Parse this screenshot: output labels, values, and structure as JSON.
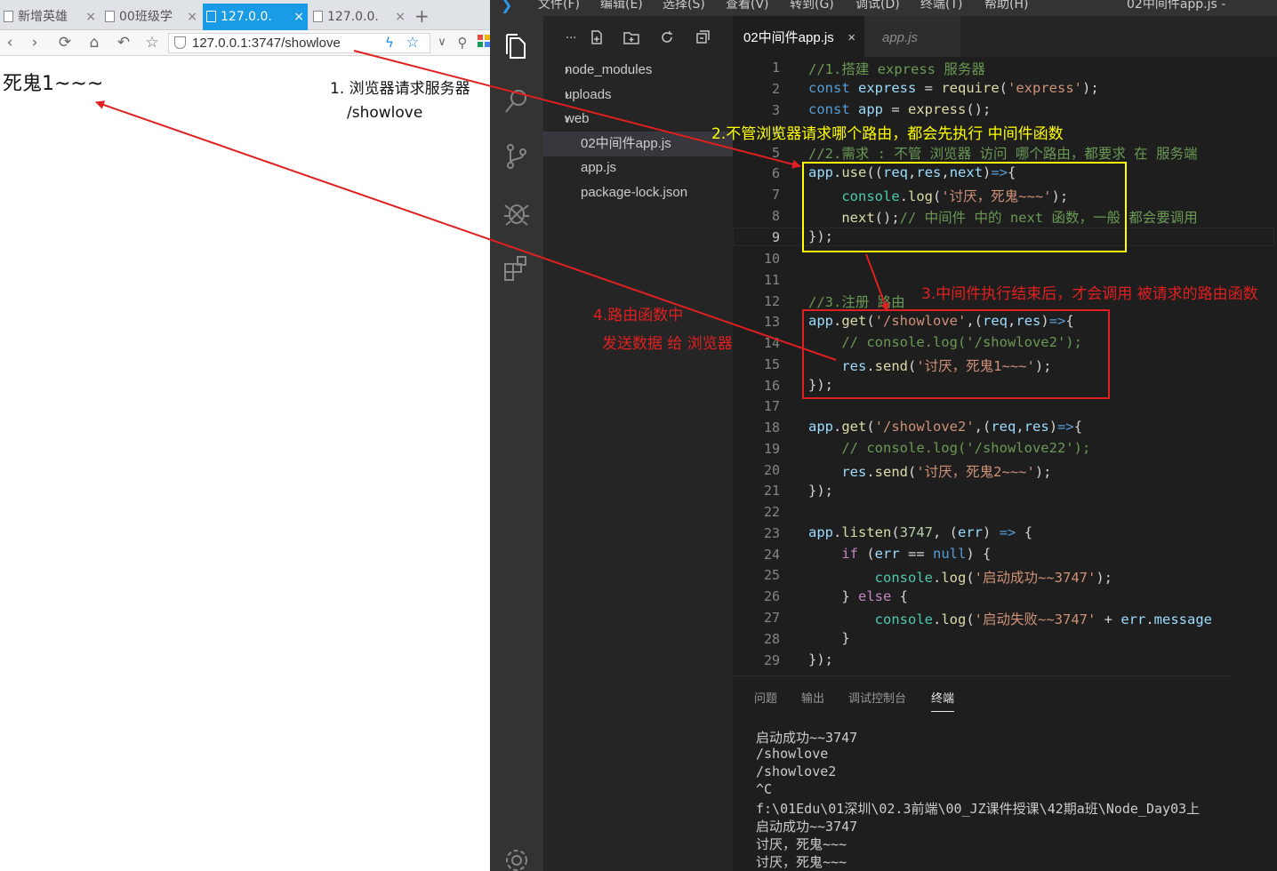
{
  "browser": {
    "tabs": [
      {
        "label": "新增英雄",
        "close": "×"
      },
      {
        "label": "00班级学",
        "close": "×"
      },
      {
        "label": "127.0.0.",
        "close": "×"
      },
      {
        "label": "127.0.0.",
        "close": "×"
      }
    ],
    "new_tab": "+",
    "url": "127.0.0.1:3747/showlove",
    "page_text": "死鬼1~~~"
  },
  "vscode": {
    "menu": [
      "文件(F)",
      "编辑(E)",
      "选择(S)",
      "查看(V)",
      "转到(G)",
      "调试(D)",
      "终端(T)",
      "帮助(H)"
    ],
    "title": "02中间件app.js -",
    "explorer": {
      "more": "...",
      "items": [
        {
          "label": "node_modules",
          "folder": true
        },
        {
          "label": "uploads",
          "folder": true
        },
        {
          "label": "web",
          "folder": true
        },
        {
          "label": "02中间件app.js",
          "folder": false,
          "selected": true
        },
        {
          "label": "app.js",
          "folder": false
        },
        {
          "label": "package-lock.json",
          "folder": false
        }
      ]
    },
    "editor_tabs": [
      {
        "label": "02中间件app.js",
        "close": "×",
        "active": true
      },
      {
        "label": "app.js",
        "active": false
      }
    ],
    "line_numbers": [
      "1",
      "2",
      "3",
      "4",
      "5",
      "6",
      "7",
      "8",
      "9",
      "10",
      "11",
      "12",
      "13",
      "14",
      "15",
      "16",
      "17",
      "18",
      "19",
      "20",
      "21",
      "22",
      "23",
      "24",
      "25",
      "26",
      "27",
      "28",
      "29"
    ],
    "panel_tabs": [
      "问题",
      "输出",
      "调试控制台",
      "终端"
    ],
    "terminal_lines": [
      "启动成功~~3747",
      "/showlove",
      "/showlove2",
      "^C",
      "f:\\01Edu\\01深圳\\02.3前端\\00_JZ课件授课\\42期a班\\Node_Day03上",
      "启动成功~~3747",
      "讨厌，死鬼~~~",
      "讨厌，死鬼~~~"
    ]
  },
  "annotations": {
    "a1_line1": "1. 浏览器请求服务器",
    "a1_line2": "/showlove",
    "a2": "2.不管浏览器请求哪个路由，都会先执行 中间件函数",
    "a3": "3.中间件执行结束后，才会调用 被请求的路由函数",
    "a4_line1": "4.路由函数中",
    "a4_line2": "发送数据 给 浏览器"
  },
  "colors": {
    "annotation_red": "#e02020",
    "annotation_yellow": "#ffff00",
    "browser_tab_active": "#1a9be6",
    "vscode_bg": "#1e1e1e"
  }
}
